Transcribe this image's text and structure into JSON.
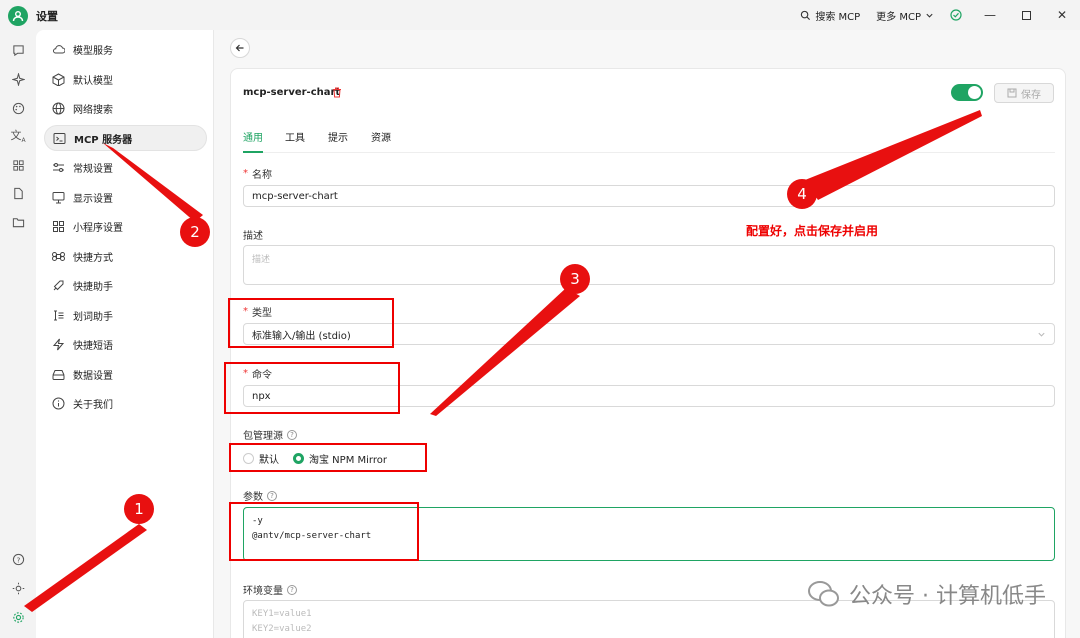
{
  "app": {
    "title": "设置"
  },
  "titlebar": {
    "search_mcp": "搜索 MCP",
    "more_mcp": "更多 MCP"
  },
  "nav": {
    "items": [
      {
        "label": "模型服务",
        "icon": "cloud-icon"
      },
      {
        "label": "默认模型",
        "icon": "cube-icon"
      },
      {
        "label": "网络搜索",
        "icon": "globe-icon"
      },
      {
        "label": "MCP 服务器",
        "icon": "terminal-icon",
        "active": true
      },
      {
        "label": "常规设置",
        "icon": "sliders-icon"
      },
      {
        "label": "显示设置",
        "icon": "monitor-icon"
      },
      {
        "label": "小程序设置",
        "icon": "grid-icon"
      },
      {
        "label": "快捷方式",
        "icon": "command-icon"
      },
      {
        "label": "快捷助手",
        "icon": "rocket-icon"
      },
      {
        "label": "划词助手",
        "icon": "text-select-icon"
      },
      {
        "label": "快捷短语",
        "icon": "zap-icon"
      },
      {
        "label": "数据设置",
        "icon": "storage-icon"
      },
      {
        "label": "关于我们",
        "icon": "info-icon"
      }
    ]
  },
  "server": {
    "name": "mcp-server-chart",
    "save_label": "保存",
    "enabled": true,
    "tabs": [
      "通用",
      "工具",
      "提示",
      "资源"
    ],
    "fields": {
      "name_label": "名称",
      "name_value": "mcp-server-chart",
      "desc_label": "描述",
      "desc_placeholder": "描述",
      "type_label": "类型",
      "type_value": "标准输入/输出 (stdio)",
      "command_label": "命令",
      "command_value": "npx",
      "registry_label": "包管理源",
      "registry_options": [
        "默认",
        "淘宝 NPM Mirror"
      ],
      "registry_selected": "淘宝 NPM Mirror",
      "args_label": "参数",
      "args_lines": [
        "-y",
        "@antv/mcp-server-chart"
      ],
      "env_label": "环境变量",
      "env_placeholder_lines": [
        "KEY1=value1",
        "KEY2=value2"
      ]
    }
  },
  "annotations": {
    "n1": "1",
    "n2": "2",
    "n3": "3",
    "n4": "4",
    "note": "配置好，点击保存并启用",
    "watermark": "公众号 · 计算机低手",
    "color": "#e81010"
  },
  "colors": {
    "accent": "#1fa463",
    "annotation": "#e81010"
  }
}
